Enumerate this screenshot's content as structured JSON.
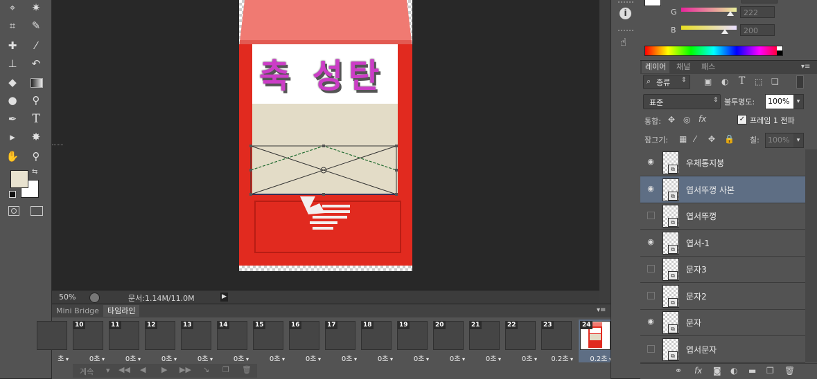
{
  "colors": {
    "fg": "#e8e2cf",
    "bg": "#ffffff",
    "sel_layer": "#5e6e84",
    "roof": "#f07a72",
    "box_red": "#e02a1e",
    "text_magenta": "#cc3dc7"
  },
  "tools": [
    "lasso-icon",
    "magic-wand-icon",
    "crop-icon",
    "eyedropper-icon",
    "healing-icon",
    "brush-icon",
    "stamp-icon",
    "history-brush-icon",
    "eraser-icon",
    "gradient-icon",
    "blur-icon",
    "dodge-icon",
    "pen-icon",
    "type-icon",
    "path-select-icon",
    "shape-icon",
    "hand-icon",
    "zoom-icon"
  ],
  "type_tool_glyph": "T",
  "canvas": {
    "poster_text": "축 성탄"
  },
  "status": {
    "zoom": "50%",
    "doc_info": "문서:1.14M/11.0M"
  },
  "timeline": {
    "tabs": [
      "Mini Bridge",
      "타임라인"
    ],
    "frames": [
      {
        "num": "",
        "delay": "초"
      },
      {
        "num": "10",
        "delay": "0초"
      },
      {
        "num": "11",
        "delay": "0초"
      },
      {
        "num": "12",
        "delay": "0초"
      },
      {
        "num": "13",
        "delay": "0초"
      },
      {
        "num": "14",
        "delay": "0초"
      },
      {
        "num": "15",
        "delay": "0초"
      },
      {
        "num": "16",
        "delay": "0초"
      },
      {
        "num": "17",
        "delay": "0초"
      },
      {
        "num": "18",
        "delay": "0초"
      },
      {
        "num": "19",
        "delay": "0초"
      },
      {
        "num": "20",
        "delay": "0초"
      },
      {
        "num": "21",
        "delay": "0초"
      },
      {
        "num": "22",
        "delay": "0초"
      },
      {
        "num": "23",
        "delay": "0.2초"
      },
      {
        "num": "24",
        "delay": "0.2초"
      }
    ],
    "loop": "계속"
  },
  "color_panel": {
    "g_label": "G",
    "g_value": "222",
    "b_label": "B",
    "b_value": "200"
  },
  "layers_panel": {
    "tabs": [
      "레이어",
      "채널",
      "패스"
    ],
    "filter_kind": "종류",
    "blend_mode": "표준",
    "opacity_label": "불투명도:",
    "opacity_value": "100%",
    "unify_label": "통합:",
    "propagate_label": "프레임 1 전파",
    "lock_label": "잠그기:",
    "fill_label": "칠:",
    "fill_value": "100%",
    "layers": [
      {
        "name": "우체통지붕",
        "visible": true
      },
      {
        "name": "엽서뚜껑 사본",
        "visible": true,
        "selected": true
      },
      {
        "name": "엽서뚜껑",
        "visible": false
      },
      {
        "name": "엽서-1",
        "visible": true
      },
      {
        "name": "문자3",
        "visible": false
      },
      {
        "name": "문자2",
        "visible": false
      },
      {
        "name": "문자",
        "visible": true
      },
      {
        "name": "엽서문자",
        "visible": false
      }
    ]
  }
}
